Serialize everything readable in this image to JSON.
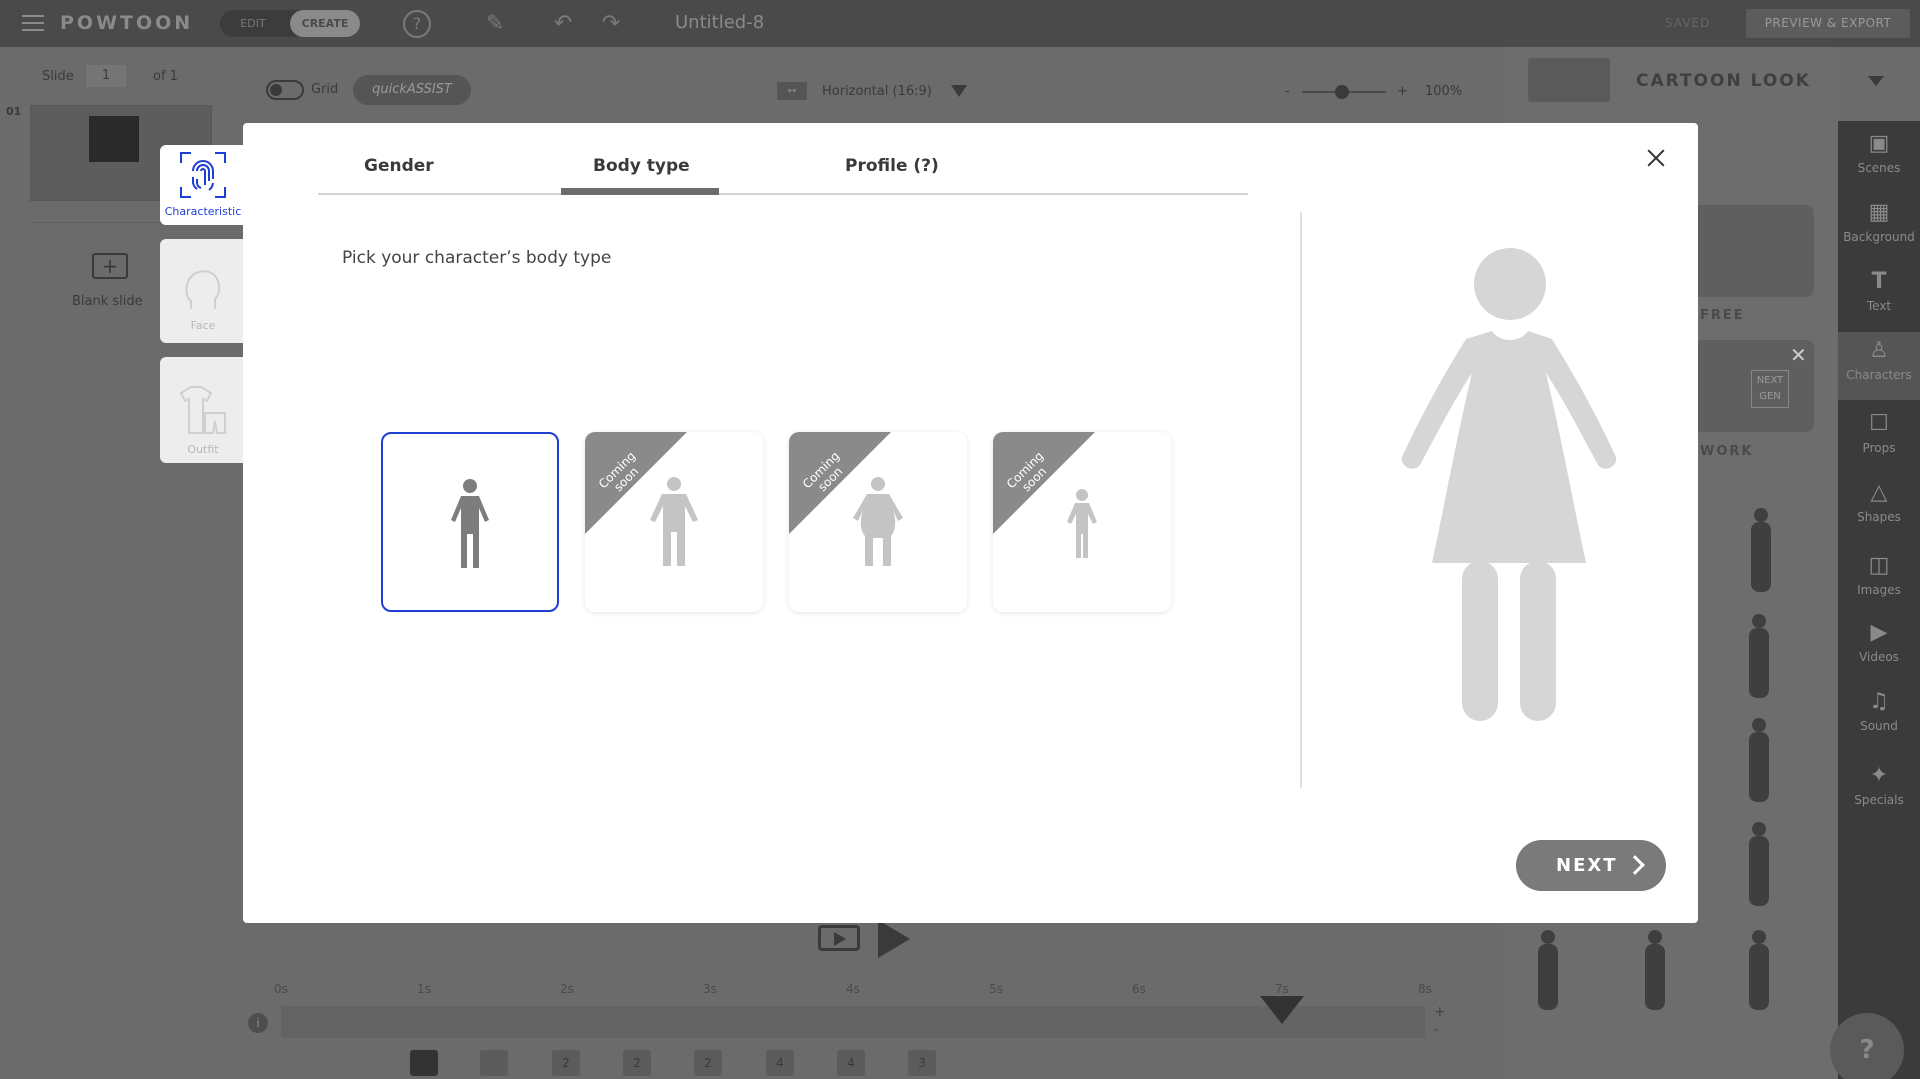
{
  "app": {
    "logo": "POWTOON",
    "mode_edit": "EDIT",
    "mode_create": "CREATE",
    "doc_title": "Untitled-8",
    "saved": "SAVED",
    "preview_export": "PREVIEW & EXPORT"
  },
  "slides": {
    "slide_label": "Slide",
    "current": "1",
    "of_label": "of 1",
    "thumb_number": "01",
    "blank_slide": "Blank slide"
  },
  "canvas": {
    "grid_label": "Grid",
    "quick_assist": "quickASSIST",
    "orientation": "Horizontal (16:9)",
    "zoom": "100%"
  },
  "library": {
    "style_name": "CARTOON LOOK",
    "labels": [
      "FREE",
      "WORK"
    ],
    "next_gen_badge": "NEXT GEN"
  },
  "sidebar": {
    "items": [
      {
        "label": "Scenes",
        "icon": "scenes-icon"
      },
      {
        "label": "Background",
        "icon": "background-icon"
      },
      {
        "label": "Text",
        "icon": "text-icon"
      },
      {
        "label": "Characters",
        "icon": "characters-icon"
      },
      {
        "label": "Props",
        "icon": "props-icon"
      },
      {
        "label": "Shapes",
        "icon": "shapes-icon"
      },
      {
        "label": "Images",
        "icon": "images-icon"
      },
      {
        "label": "Videos",
        "icon": "videos-icon"
      },
      {
        "label": "Sound",
        "icon": "sound-icon"
      },
      {
        "label": "Specials",
        "icon": "specials-icon"
      }
    ],
    "help": "?"
  },
  "timeline": {
    "ticks": [
      "0s",
      "1s",
      "2s",
      "3s",
      "4s",
      "5s",
      "6s",
      "7s",
      "8s"
    ],
    "layer_counts": [
      "",
      "",
      "2",
      "2",
      "2",
      "4",
      "4",
      "3"
    ],
    "info": "i"
  },
  "modal": {
    "steps": [
      {
        "label": "Characteristic",
        "icon": "fingerprint-icon"
      },
      {
        "label": "Face",
        "icon": "face-icon"
      },
      {
        "label": "Outfit",
        "icon": "outfit-icon"
      }
    ],
    "tabs": [
      "Gender",
      "Body type",
      "Profile (?)"
    ],
    "active_tab": "Body type",
    "instruction": "Pick your character’s body type",
    "body_types": [
      {
        "selected": true,
        "ribbon": ""
      },
      {
        "selected": false,
        "ribbon": "Coming soon"
      },
      {
        "selected": false,
        "ribbon": "Coming soon"
      },
      {
        "selected": false,
        "ribbon": "Coming soon"
      }
    ],
    "next_label": "NEXT",
    "accent": "#1e3fd4"
  }
}
